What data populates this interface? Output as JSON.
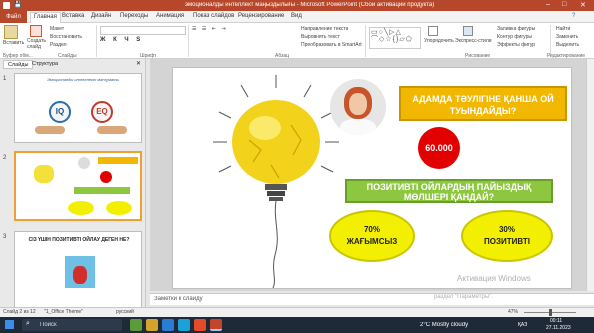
{
  "window": {
    "title": "эмоционалды интеллект маңыздылығы  -  Microsoft PowerPoint (Сбой активации продукта)"
  },
  "tabs": [
    "Файл",
    "Главная",
    "Вставка",
    "Дизайн",
    "Переходы",
    "Анимация",
    "Показ слайдов",
    "Рецензирование",
    "Вид"
  ],
  "ribbon": {
    "paste": "Вставить",
    "create_slide": "Создать слайд",
    "layout": "Макет",
    "restore": "Восстановить",
    "section": "Раздел",
    "text_direction": "Направление текста",
    "align_text": "Выровнять текст",
    "convert_smartart": "Преобразовать в SmartArt",
    "arrange": "Упорядочить",
    "quick_styles": "Экспресс-стили",
    "shape_fill": "Заливка фигуры",
    "shape_outline": "Контур фигуры",
    "shape_effects": "Эффекты фигур",
    "find": "Найти",
    "replace": "Заменить",
    "select": "Выделить",
    "groups": {
      "clipboard": "Буфер обм...",
      "slides": "Слайды",
      "font": "Шрифт",
      "paragraph": "Абзац",
      "drawing": "Рисование",
      "editing": "Редактирование"
    }
  },
  "left_pane": {
    "tabs": [
      "Слайды",
      "Структура"
    ],
    "slide1": {
      "num": "1",
      "title": "Эмоционалды интеллект мағлұматы",
      "iq": "IQ",
      "eq": "EQ"
    },
    "slide2": {
      "num": "2"
    },
    "slide3": {
      "num": "3",
      "title": "СІЗ ҮШІН ПОЗИТИВТІ ОЙЛАУ ДЕГЕН НЕ?"
    }
  },
  "slide": {
    "q1": "АДАМДА ТӘУЛІГІНЕ ҚАНША ОЙ ТУЫНДАЙДЫ?",
    "number": "60.000",
    "q2": "ПОЗИТИВТІ ОЙЛАРДЫҢ ПАЙЫЗДЫҚ МӨЛШЕРІ ҚАНДАЙ?",
    "a1_pct": "70%",
    "a1_label": "ЖАҒЫМСЫЗ",
    "a2_pct": "30%",
    "a2_label": "ПОЗИТИВТІ",
    "watermark1": "Активация Windows",
    "watermark2": "раздел \"Параметры\"."
  },
  "notes": {
    "placeholder": "Заметки к слайду"
  },
  "status": {
    "slide": "Слайд 2 из 12",
    "theme": "\"1_Office Theme\"",
    "lang": "русский",
    "zoom": "47%"
  },
  "taskbar": {
    "search": "Поиск",
    "weather": "2°C  Mostly cloudy",
    "lang": "ҚАЗ",
    "time": "00:11",
    "date": "27.11.2023"
  }
}
